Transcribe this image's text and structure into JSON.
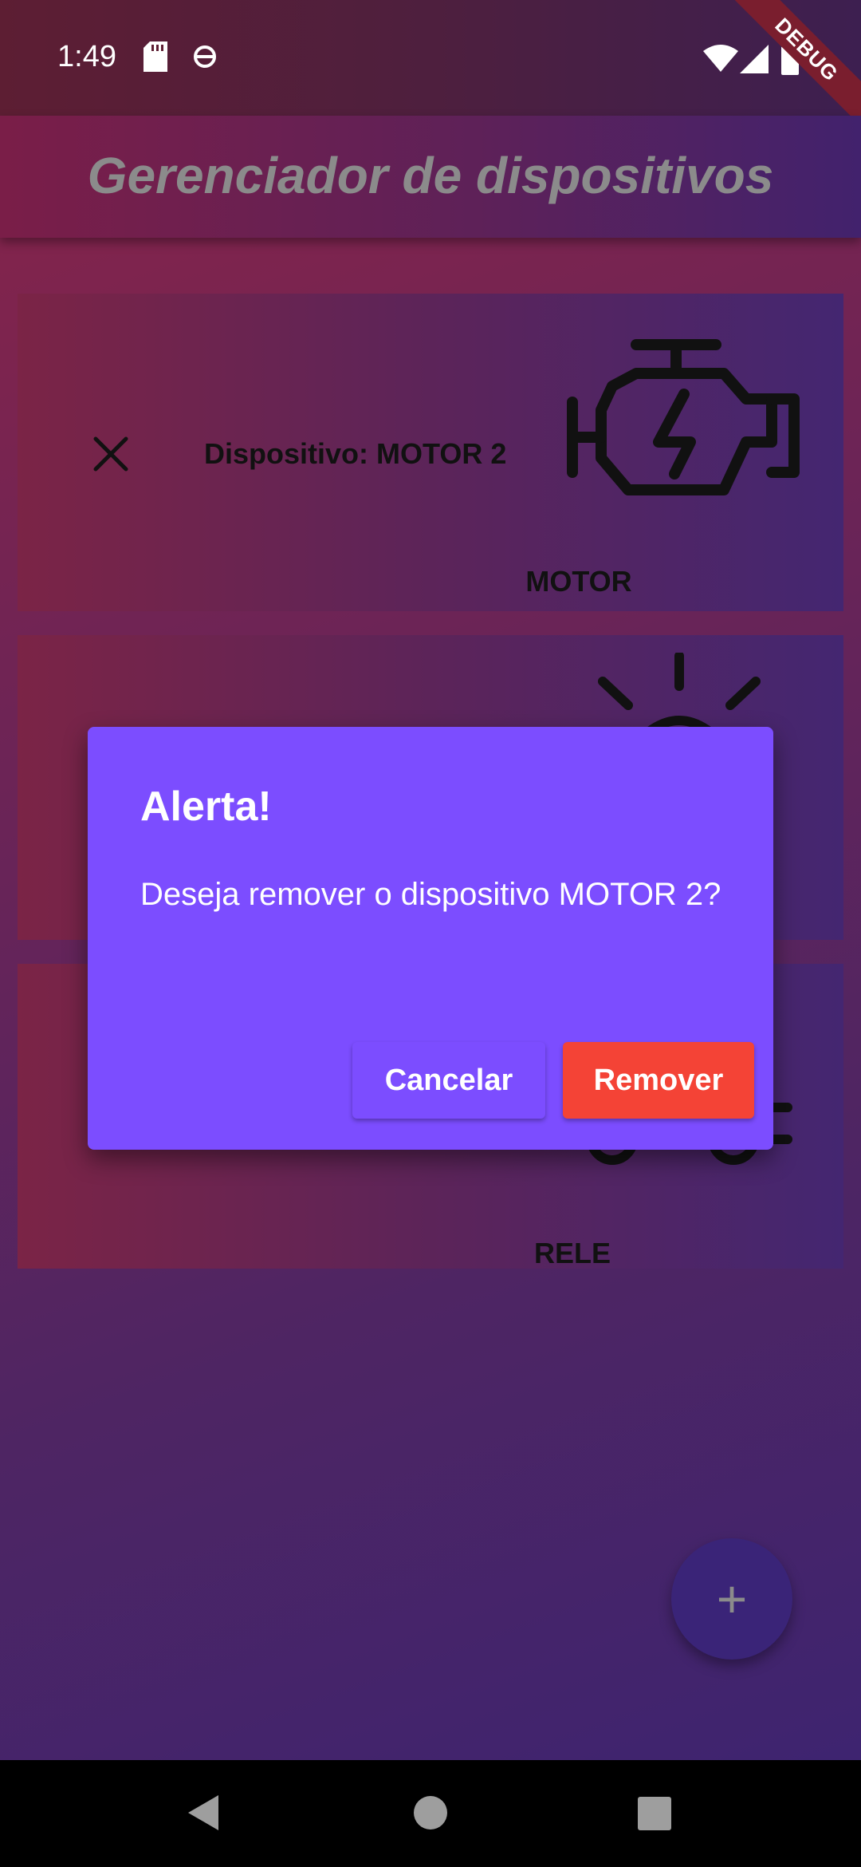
{
  "status_bar": {
    "time": "1:49",
    "icons": [
      "sd-card-icon",
      "assistant-icon",
      "wifi-icon",
      "signal-icon",
      "battery-icon"
    ]
  },
  "debug_banner": "DEBUG",
  "app_bar": {
    "title": "Gerenciador de dispositivos"
  },
  "devices": [
    {
      "label": "Dispositivo: MOTOR 2",
      "type": "MOTOR",
      "icon": "engine-icon"
    },
    {
      "label": "",
      "type": "",
      "icon": "light-bulb-icon"
    },
    {
      "label": "",
      "type": "RELE",
      "icon": "relay-icon"
    }
  ],
  "dialog": {
    "title": "Alerta!",
    "message": "Deseja remover o dispositivo MOTOR 2?",
    "cancel_label": "Cancelar",
    "remove_label": "Remover"
  },
  "fab": {
    "icon": "plus-icon",
    "symbol": "+"
  },
  "nav_bar": {
    "buttons": [
      "back-icon",
      "home-icon",
      "recents-icon"
    ]
  },
  "colors": {
    "dialog_bg": "#7c4dff",
    "remove_button": "#f44336",
    "fab_bg": "#3a2478"
  }
}
